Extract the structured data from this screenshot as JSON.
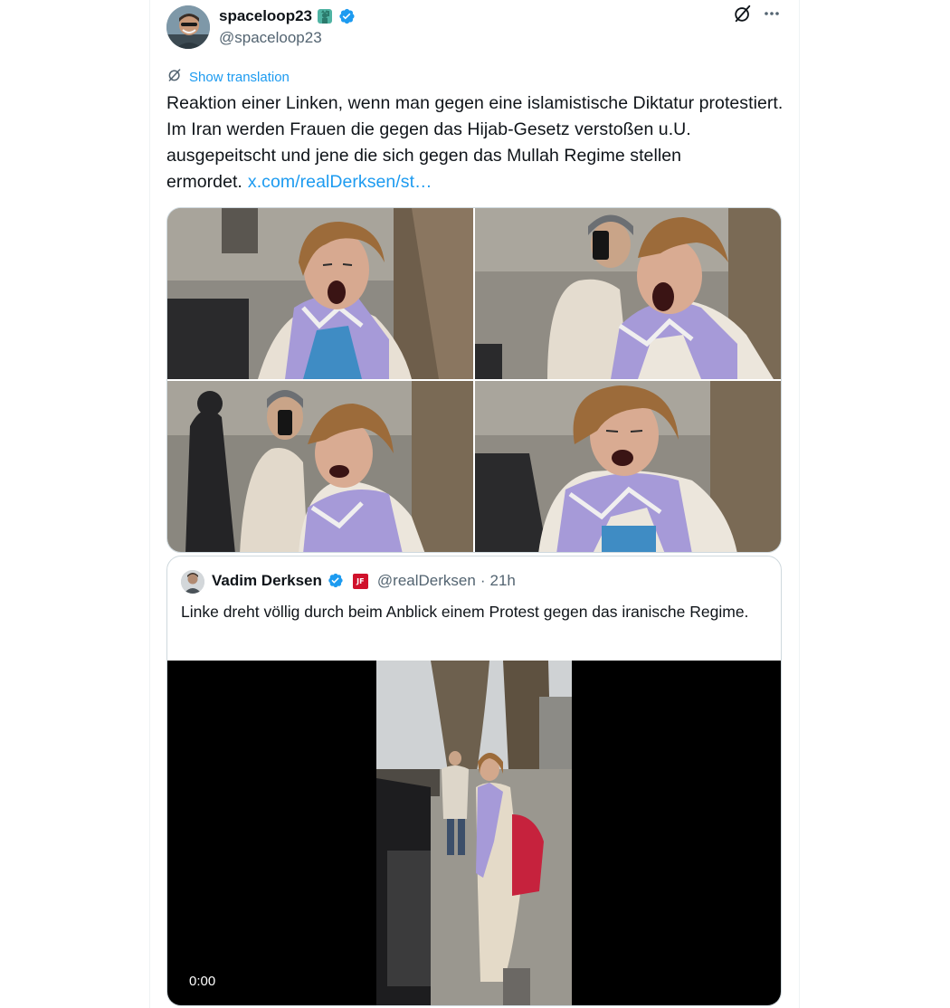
{
  "author": {
    "display_name": "spaceloop23",
    "emoji_badge": "statue-of-liberty-emoji",
    "handle": "@spaceloop23",
    "verified": true
  },
  "header_actions": {
    "grok_icon": "grok-icon",
    "more_icon": "more-horizontal-icon"
  },
  "translation": {
    "label": "Show translation"
  },
  "tweet": {
    "text": "Reaktion einer Linken, wenn man gegen eine islamistische Diktatur protestiert. Im Iran werden Frauen die gegen das Hijab-Gesetz verstoßen u.U. ausgepeitscht und jene die sich gegen das Mullah Regime stellen ermordet.",
    "link": "x.com/realDerksen/st…"
  },
  "media": {
    "count": 4
  },
  "quoted_tweet": {
    "display_name": "Vadim Derksen",
    "verified": true,
    "affiliate_badge": "JF",
    "handle": "@realDerksen",
    "separator": "·",
    "time": "21h",
    "text": "Linke dreht völlig durch beim Anblick einem Protest gegen das iranische Regime.",
    "video": {
      "timestamp": "0:00"
    }
  },
  "colors": {
    "accent": "#1d9bf0",
    "text_primary": "#0f1419",
    "text_secondary": "#536471",
    "border": "#cfd9de",
    "affiliate_red": "#d0112b"
  }
}
